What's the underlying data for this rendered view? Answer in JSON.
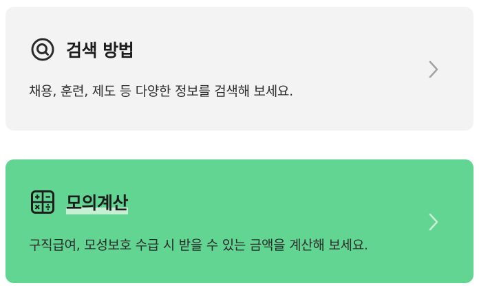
{
  "cards": [
    {
      "title": "검색 방법",
      "description": "채용, 훈련, 제도 등 다양한 정보를 검색해 보세요.",
      "icon": "search-icon",
      "background": "#f3f3f4"
    },
    {
      "title": "모의계산",
      "description": "구직급여, 모성보호 수급 시 받을 수 있는 금액을 계산해 보세요.",
      "icon": "calculator-icon",
      "background": "#62d592"
    }
  ],
  "chevron_icon": "chevron-right-icon",
  "colors": {
    "text": "#1c1c1c",
    "chevron_light": "#9e9e9e",
    "chevron_on_green": "#c9efd6"
  }
}
